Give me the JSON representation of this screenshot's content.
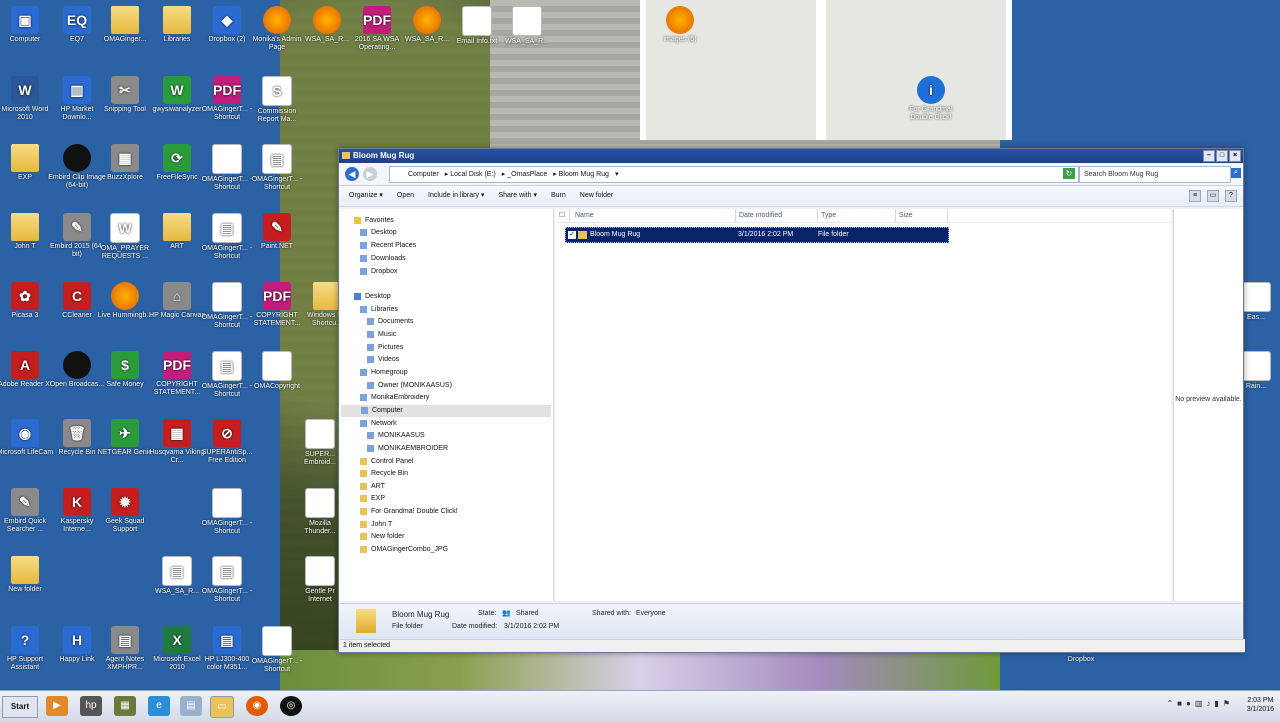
{
  "desktop": {
    "icons": [
      {
        "label": "Computer"
      },
      {
        "label": "EQ7"
      },
      {
        "label": "OMAGinger..."
      },
      {
        "label": "Libraries"
      },
      {
        "label": "Dropbox (2)"
      },
      {
        "label": "Monika's Admin Page"
      },
      {
        "label": "WSA_SA_R..."
      },
      {
        "label": "2016 SA WSA Operating..."
      },
      {
        "label": "WSA_SA_R..."
      },
      {
        "label": "Email Info.txt"
      },
      {
        "label": "WSA_SA_R..."
      },
      {
        "label": "images (6)"
      },
      {
        "label": "Microsoft Word 2010"
      },
      {
        "label": "HP Market Downlo..."
      },
      {
        "label": "Snipping Tool"
      },
      {
        "label": "gwysiwanalyzer"
      },
      {
        "label": "OMAGingerT... - Shortcut"
      },
      {
        "label": "Commission Report Ma..."
      },
      {
        "label": "EXP"
      },
      {
        "label": "Embird Clip Image (64-bit)"
      },
      {
        "label": "BuzzXplore"
      },
      {
        "label": "FreeFileSync"
      },
      {
        "label": "OMAGingerT... - Shortcut"
      },
      {
        "label": "OMAGingerT... - Shortcut"
      },
      {
        "label": "John T"
      },
      {
        "label": "Embird 2015 (64-bit)"
      },
      {
        "label": "OMA_PRAYER REQUESTS ..."
      },
      {
        "label": "ART"
      },
      {
        "label": "OMAGingerT... - Shortcut"
      },
      {
        "label": "Paint.NET"
      },
      {
        "label": "Picasa 3"
      },
      {
        "label": "CCleaner"
      },
      {
        "label": "Live Hummingb..."
      },
      {
        "label": "HP Magic Canvas"
      },
      {
        "label": "OMAGingerT... - Shortcut"
      },
      {
        "label": "COPYRIGHT STATEMENT..."
      },
      {
        "label": "Windows L... Shortcu..."
      },
      {
        "label": "Adobe Reader XI"
      },
      {
        "label": "Open Broadcas..."
      },
      {
        "label": "Safe Money"
      },
      {
        "label": "COPYRIGHT STATEMENT..."
      },
      {
        "label": "OMAGingerT... - Shortcut"
      },
      {
        "label": "OMACopyright"
      },
      {
        "label": "Microsoft LifeCam"
      },
      {
        "label": "Recycle Bin"
      },
      {
        "label": "NETGEAR Genie"
      },
      {
        "label": "Husqvarna Viking Cr..."
      },
      {
        "label": "SUPERAntiSp... Free Edition"
      },
      {
        "label": "Embird Quick Searcher ..."
      },
      {
        "label": "Kaspersky Interne..."
      },
      {
        "label": "Geek Squad Support"
      },
      {
        "label": "OMAGingerT... - Shortcut"
      },
      {
        "label": "New folder"
      },
      {
        "label": "WSA_SA_R..."
      },
      {
        "label": "OMAGingerT... - Shortcut"
      },
      {
        "label": "HP Support Assistant"
      },
      {
        "label": "Happy Link"
      },
      {
        "label": "Agent Notes XMPHPR..."
      },
      {
        "label": "Microsoft Excel 2010"
      },
      {
        "label": "HP LJ300-400 color M351..."
      },
      {
        "label": "OMAGingerT... - Shortcut"
      },
      {
        "label": "For Grandma! Double Click!"
      },
      {
        "label": "Dropbox"
      }
    ],
    "partial_labels": [
      "Eas...",
      "Rain...",
      "SUPER... Embroid...",
      "Mozilla Thunder...",
      "Gentle Pr Internet"
    ]
  },
  "window": {
    "title": "Bloom Mug Rug",
    "address": [
      "Computer",
      "Local Disk (E:)",
      "_OmasPlace",
      "Bloom Mug Rug"
    ],
    "search_placeholder": "Search Bloom Mug Rug",
    "toolbar": [
      "Organize ▾",
      "Open",
      "Include in library ▾",
      "Share with ▾",
      "Burn",
      "New folder"
    ],
    "nav": [
      {
        "label": "Favorites",
        "level": 0
      },
      {
        "label": "Desktop",
        "level": 1
      },
      {
        "label": "Recent Places",
        "level": 1
      },
      {
        "label": "Downloads",
        "level": 1
      },
      {
        "label": "Dropbox",
        "level": 1
      },
      {
        "label": "Desktop",
        "level": 0
      },
      {
        "label": "Libraries",
        "level": 1
      },
      {
        "label": "Documents",
        "level": 2
      },
      {
        "label": "Music",
        "level": 2
      },
      {
        "label": "Pictures",
        "level": 2
      },
      {
        "label": "Videos",
        "level": 2
      },
      {
        "label": "Homegroup",
        "level": 1
      },
      {
        "label": "Owner (MONIKAASUS)",
        "level": 2
      },
      {
        "label": "MonikaEmbroidery",
        "level": 1
      },
      {
        "label": "Computer",
        "level": 1
      },
      {
        "label": "Network",
        "level": 1
      },
      {
        "label": "MONIKAASUS",
        "level": 2
      },
      {
        "label": "MONIKAEMBROIDER",
        "level": 2
      },
      {
        "label": "Control Panel",
        "level": 1
      },
      {
        "label": "Recycle Bin",
        "level": 1
      },
      {
        "label": "ART",
        "level": 1
      },
      {
        "label": "EXP",
        "level": 1
      },
      {
        "label": "For Grandma! Double Click!",
        "level": 1
      },
      {
        "label": "John T",
        "level": 1
      },
      {
        "label": "New folder",
        "level": 1
      },
      {
        "label": "OMAGingerCombo_JPG",
        "level": 1
      }
    ],
    "selected_nav": "Computer",
    "columns": [
      "Name",
      "Date modified",
      "Type",
      "Size"
    ],
    "rows": [
      {
        "name": "Bloom Mug Rug",
        "date": "3/1/2016 2:02 PM",
        "type": "File folder",
        "size": ""
      }
    ],
    "preview_text": "No preview available.",
    "details": {
      "name": "Bloom Mug Rug",
      "kind": "File folder",
      "state_label": "State:",
      "state_value": "Shared",
      "shared_with_label": "Shared with:",
      "shared_with_value": "Everyone",
      "date_label": "Date modified:",
      "date_value": "3/1/2016 2:02 PM"
    },
    "status": "1 item selected"
  },
  "taskbar": {
    "start_label": "Start",
    "time": "2:03 PM",
    "date": "3/1/2016"
  }
}
